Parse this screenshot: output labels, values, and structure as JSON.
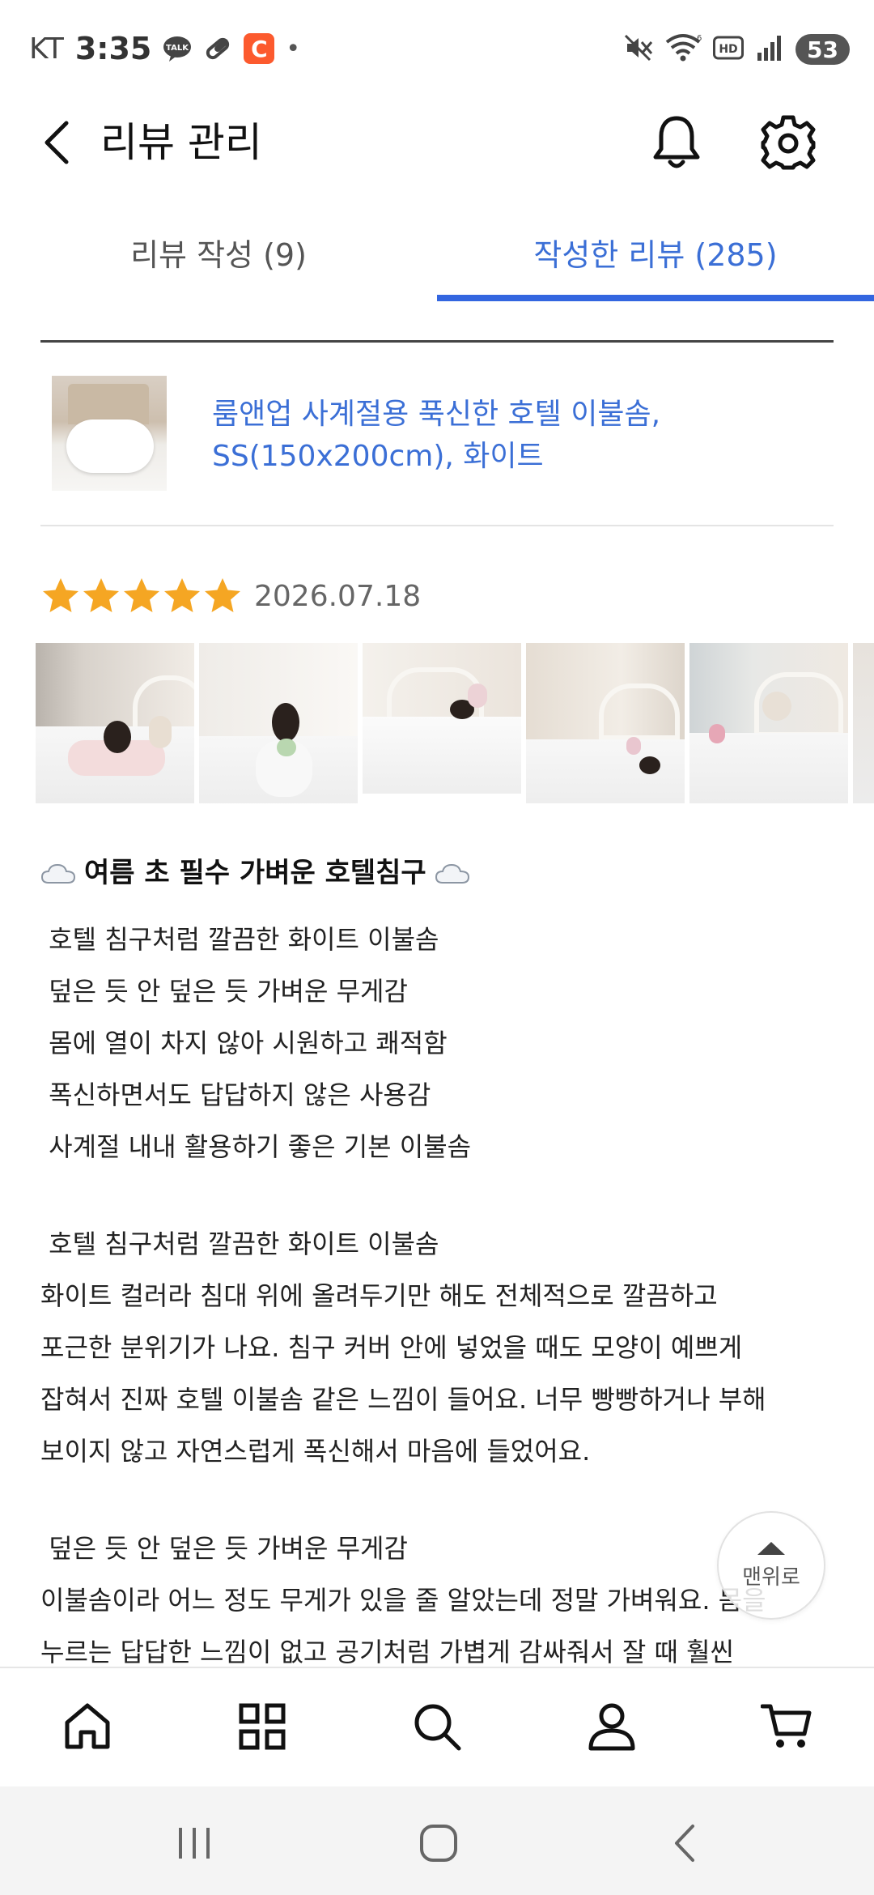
{
  "status_bar": {
    "carrier": "KT",
    "time": "3:35",
    "talk_icon_label": "TALK",
    "c_icon_label": "C",
    "dot": "•",
    "battery": "53"
  },
  "header": {
    "title": "리뷰 관리"
  },
  "tabs": [
    {
      "label": "리뷰 작성 (9)",
      "active": false
    },
    {
      "label": "작성한 리뷰 (285)",
      "active": true
    }
  ],
  "product": {
    "name": "룸앤업 사계절용 푹신한 호텔 이불솜, SS(150x200cm), 화이트"
  },
  "review": {
    "rating": 5,
    "date": "2026.07.18",
    "photo_count": 5,
    "headline": "여름 초 필수 가벼운 호텔침구",
    "summary": [
      " 호텔 침구처럼 깔끔한 화이트 이불솜",
      " 덮은 듯 안 덮은 듯 가벼운 무게감",
      " 몸에 열이 차지 않아 시원하고 쾌적함",
      " 폭신하면서도 답답하지 않은 사용감",
      " 사계절 내내 활용하기 좋은 기본 이불솜"
    ],
    "section1_title": " 호텔 침구처럼 깔끔한 화이트 이불솜",
    "section1_body": [
      "화이트 컬러라 침대 위에 올려두기만 해도 전체적으로 깔끔하고",
      "포근한 분위기가 나요. 침구 커버 안에 넣었을 때도 모양이 예쁘게",
      "잡혀서 진짜 호텔 이불솜 같은 느낌이 들어요. 너무 빵빵하거나 부해",
      "보이지 않고 자연스럽게 폭신해서 마음에 들었어요."
    ],
    "section2_title": " 덮은 듯 안 덮은 듯 가벼운 무게감",
    "section2_body": [
      "이불솜이라 어느 정도 무게가 있을 줄 알았는데 정말 가벼워요. 몸을",
      "누르는 답답한 느낌이 없고 공기처럼 가볍게 감싸줘서 잘 때 훨씬"
    ]
  },
  "scroll_top": {
    "label": "맨위로"
  },
  "colors": {
    "accent": "#3366e0",
    "link": "#3b6fd6",
    "star": "#f5a623"
  },
  "bottom_nav": [
    "home-icon",
    "grid-icon",
    "search-icon",
    "profile-icon",
    "cart-icon"
  ]
}
